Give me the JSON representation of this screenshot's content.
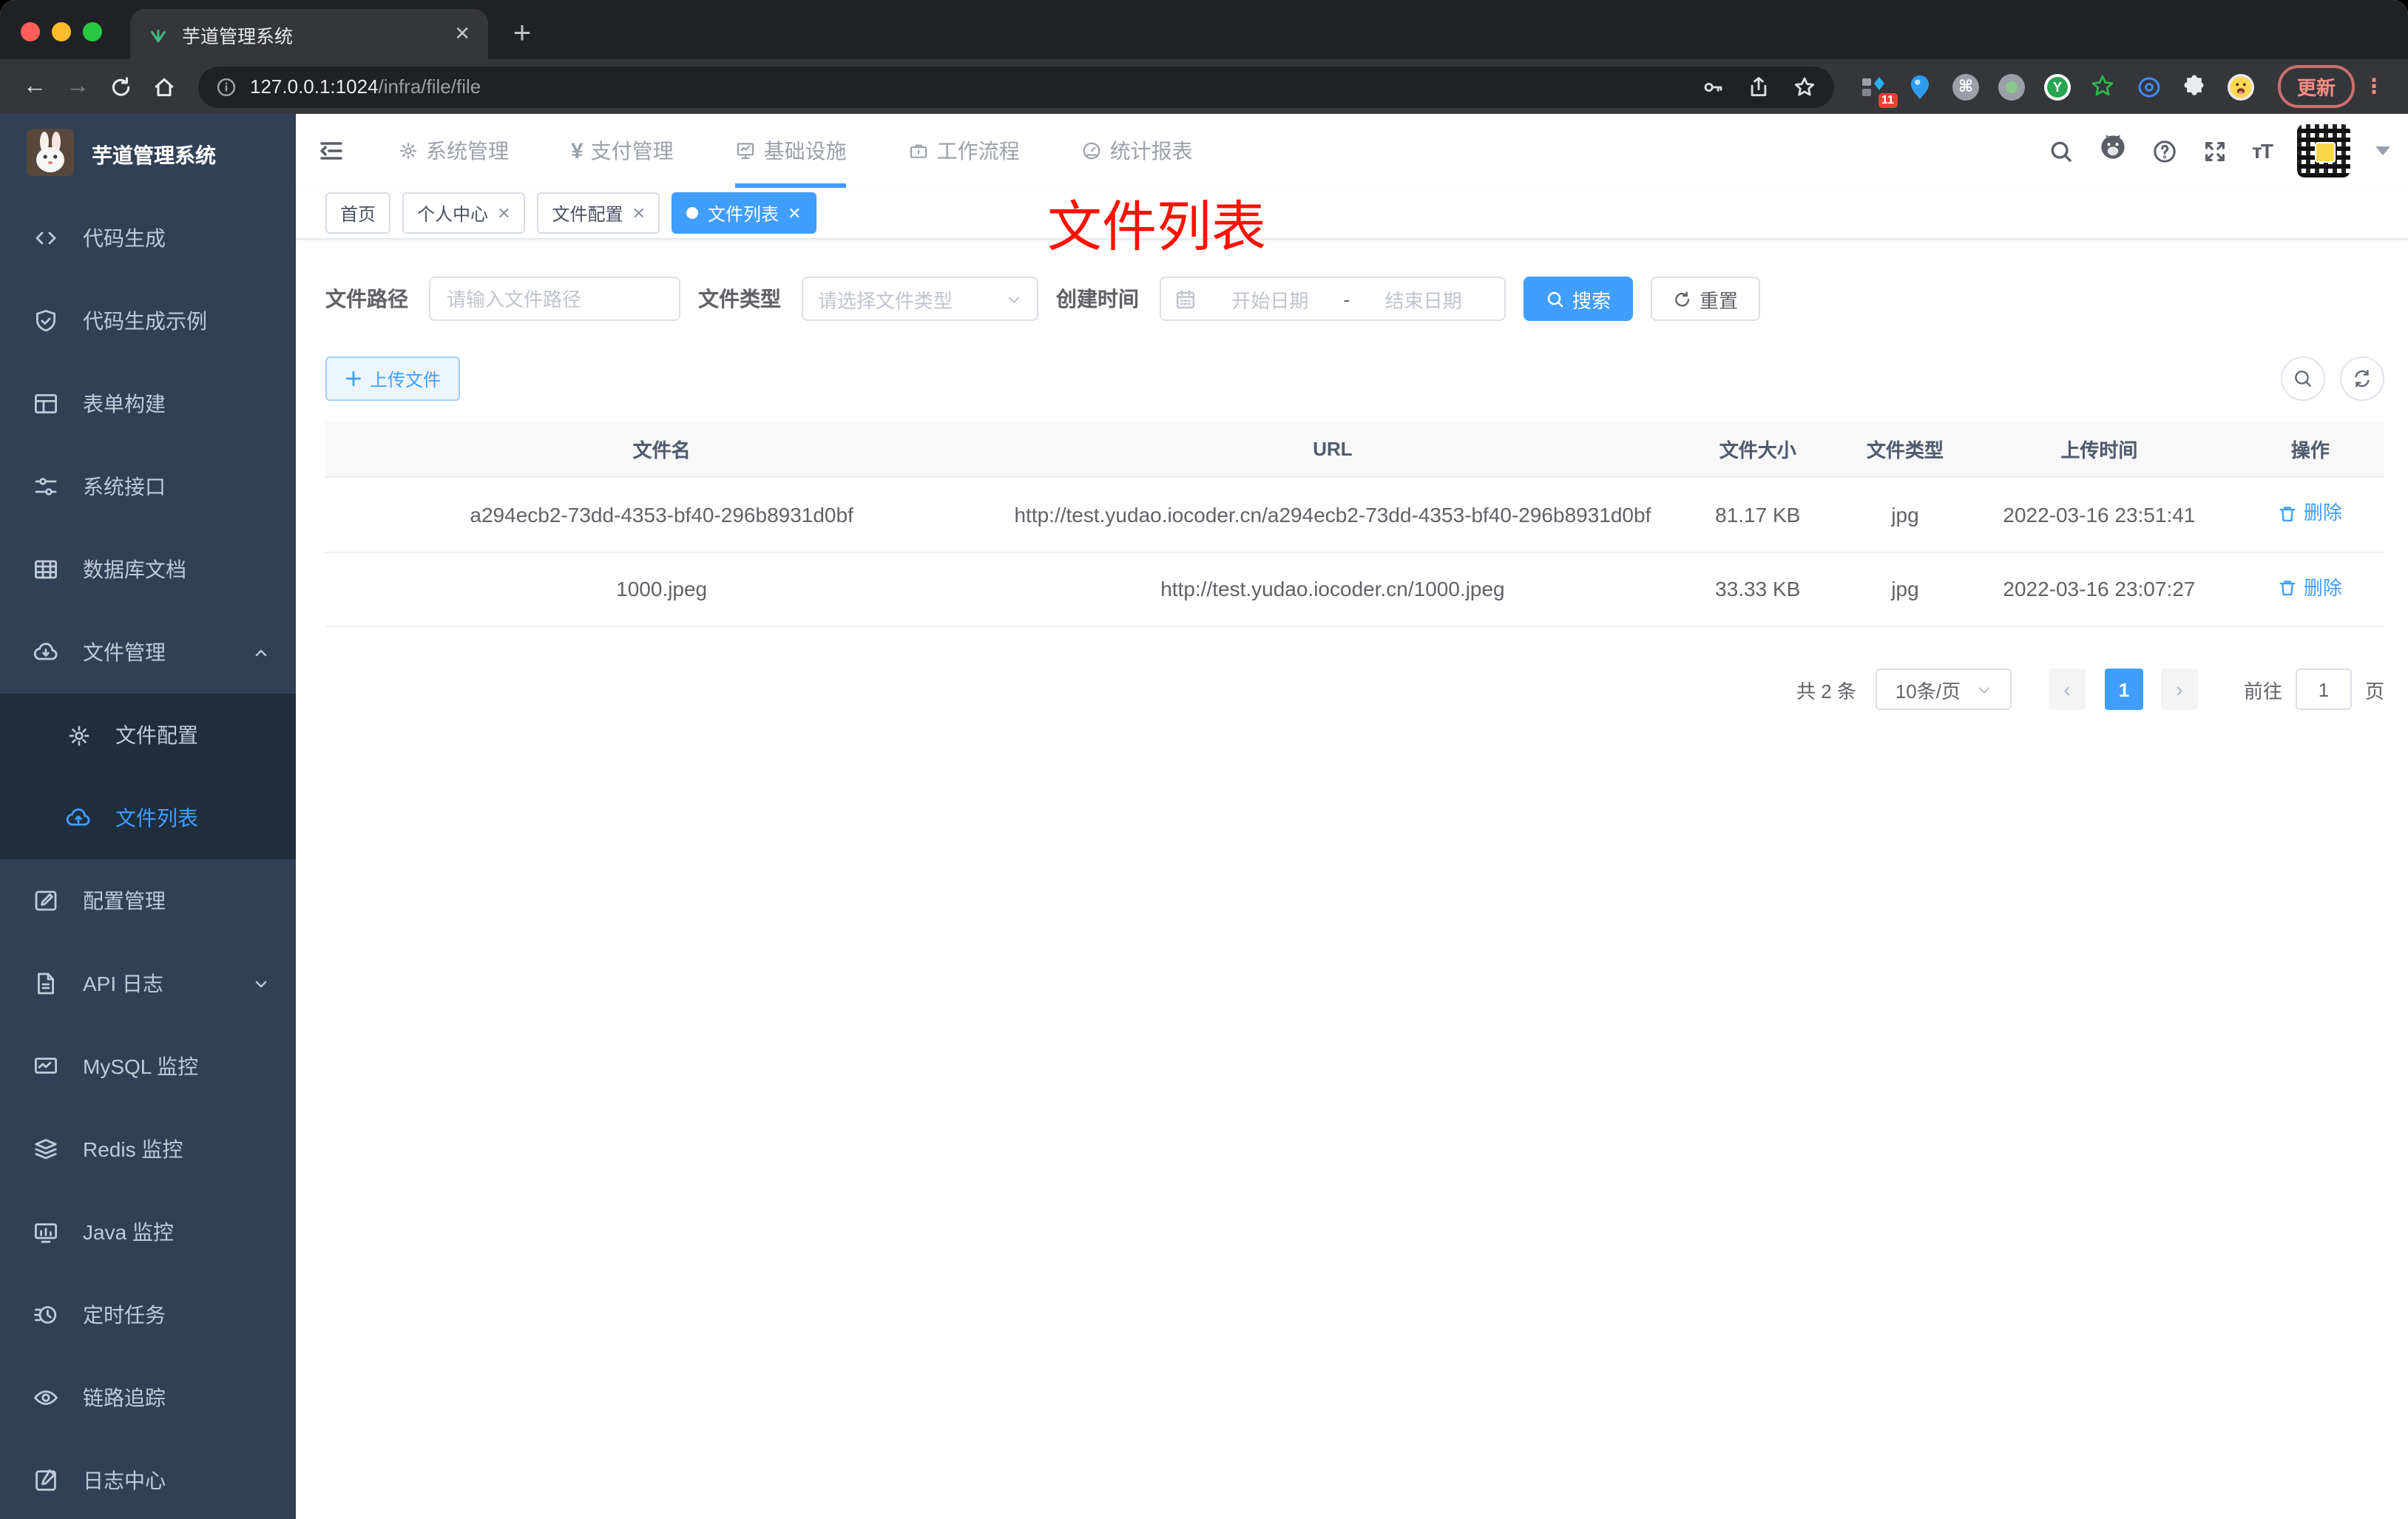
{
  "browser": {
    "tab_title": "芋道管理系统",
    "url_host": "127.0.0.1:1024",
    "url_path": "/infra/file/file",
    "ext_badge": "11",
    "update_label": "更新"
  },
  "sidebar": {
    "logo_title": "芋道管理系统",
    "items": [
      {
        "label": "代码生成"
      },
      {
        "label": "代码生成示例"
      },
      {
        "label": "表单构建"
      },
      {
        "label": "系统接口"
      },
      {
        "label": "数据库文档"
      },
      {
        "label": "文件管理"
      },
      {
        "label": "文件配置"
      },
      {
        "label": "文件列表"
      },
      {
        "label": "配置管理"
      },
      {
        "label": "API 日志"
      },
      {
        "label": "MySQL 监控"
      },
      {
        "label": "Redis 监控"
      },
      {
        "label": "Java 监控"
      },
      {
        "label": "定时任务"
      },
      {
        "label": "链路追踪"
      },
      {
        "label": "日志中心"
      }
    ]
  },
  "topnav": {
    "items": [
      {
        "label": "系统管理"
      },
      {
        "label": "支付管理"
      },
      {
        "label": "基础设施"
      },
      {
        "label": "工作流程"
      },
      {
        "label": "统计报表"
      }
    ]
  },
  "tags": [
    {
      "label": "首页"
    },
    {
      "label": "个人中心"
    },
    {
      "label": "文件配置"
    },
    {
      "label": "文件列表"
    }
  ],
  "annotation": "文件列表",
  "filters": {
    "path_label": "文件路径",
    "path_placeholder": "请输入文件路径",
    "type_label": "文件类型",
    "type_placeholder": "请选择文件类型",
    "date_label": "创建时间",
    "date_start_placeholder": "开始日期",
    "date_separator": "-",
    "date_end_placeholder": "结束日期",
    "search_label": "搜索",
    "reset_label": "重置"
  },
  "toolbar": {
    "upload_label": "上传文件"
  },
  "table": {
    "columns": [
      "文件名",
      "URL",
      "文件大小",
      "文件类型",
      "上传时间",
      "操作"
    ],
    "rows": [
      {
        "name": "a294ecb2-73dd-4353-bf40-296b8931d0bf",
        "url": "http://test.yudao.iocoder.cn/a294ecb2-73dd-4353-bf40-296b8931d0bf",
        "size": "81.17 KB",
        "type": "jpg",
        "time": "2022-03-16 23:51:41",
        "action": "删除"
      },
      {
        "name": "1000.jpeg",
        "url": "http://test.yudao.iocoder.cn/1000.jpeg",
        "size": "33.33 KB",
        "type": "jpg",
        "time": "2022-03-16 23:07:27",
        "action": "删除"
      }
    ]
  },
  "pagination": {
    "total": "共 2 条",
    "page_size": "10条/页",
    "prev": "‹",
    "current_page": "1",
    "next": "›",
    "goto_label": "前往",
    "goto_value": "1",
    "page_unit": "页"
  },
  "colors": {
    "accent": "#409eff",
    "sidebar_bg": "#304156",
    "submenu_bg": "#1f2d3d",
    "annotation_red": "#ff1000",
    "active_tag_bg": "#409eff"
  }
}
